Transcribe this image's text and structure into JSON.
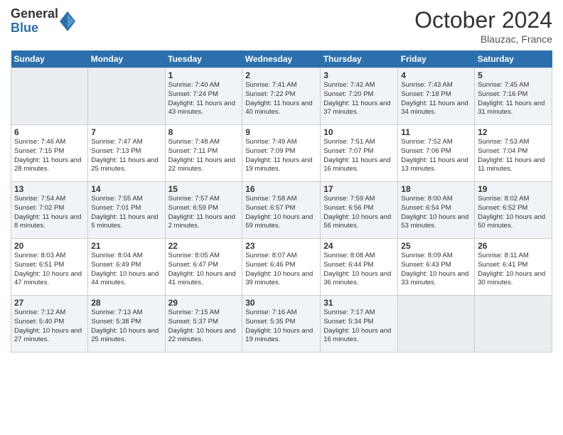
{
  "header": {
    "logo_general": "General",
    "logo_blue": "Blue",
    "month_title": "October 2024",
    "location": "Blauzac, France"
  },
  "days_of_week": [
    "Sunday",
    "Monday",
    "Tuesday",
    "Wednesday",
    "Thursday",
    "Friday",
    "Saturday"
  ],
  "weeks": [
    [
      {
        "day": "",
        "sunrise": "",
        "sunset": "",
        "daylight": ""
      },
      {
        "day": "",
        "sunrise": "",
        "sunset": "",
        "daylight": ""
      },
      {
        "day": "1",
        "sunrise": "Sunrise: 7:40 AM",
        "sunset": "Sunset: 7:24 PM",
        "daylight": "Daylight: 11 hours and 43 minutes."
      },
      {
        "day": "2",
        "sunrise": "Sunrise: 7:41 AM",
        "sunset": "Sunset: 7:22 PM",
        "daylight": "Daylight: 11 hours and 40 minutes."
      },
      {
        "day": "3",
        "sunrise": "Sunrise: 7:42 AM",
        "sunset": "Sunset: 7:20 PM",
        "daylight": "Daylight: 11 hours and 37 minutes."
      },
      {
        "day": "4",
        "sunrise": "Sunrise: 7:43 AM",
        "sunset": "Sunset: 7:18 PM",
        "daylight": "Daylight: 11 hours and 34 minutes."
      },
      {
        "day": "5",
        "sunrise": "Sunrise: 7:45 AM",
        "sunset": "Sunset: 7:16 PM",
        "daylight": "Daylight: 11 hours and 31 minutes."
      }
    ],
    [
      {
        "day": "6",
        "sunrise": "Sunrise: 7:46 AM",
        "sunset": "Sunset: 7:15 PM",
        "daylight": "Daylight: 11 hours and 28 minutes."
      },
      {
        "day": "7",
        "sunrise": "Sunrise: 7:47 AM",
        "sunset": "Sunset: 7:13 PM",
        "daylight": "Daylight: 11 hours and 25 minutes."
      },
      {
        "day": "8",
        "sunrise": "Sunrise: 7:48 AM",
        "sunset": "Sunset: 7:11 PM",
        "daylight": "Daylight: 11 hours and 22 minutes."
      },
      {
        "day": "9",
        "sunrise": "Sunrise: 7:49 AM",
        "sunset": "Sunset: 7:09 PM",
        "daylight": "Daylight: 11 hours and 19 minutes."
      },
      {
        "day": "10",
        "sunrise": "Sunrise: 7:51 AM",
        "sunset": "Sunset: 7:07 PM",
        "daylight": "Daylight: 11 hours and 16 minutes."
      },
      {
        "day": "11",
        "sunrise": "Sunrise: 7:52 AM",
        "sunset": "Sunset: 7:06 PM",
        "daylight": "Daylight: 11 hours and 13 minutes."
      },
      {
        "day": "12",
        "sunrise": "Sunrise: 7:53 AM",
        "sunset": "Sunset: 7:04 PM",
        "daylight": "Daylight: 11 hours and 11 minutes."
      }
    ],
    [
      {
        "day": "13",
        "sunrise": "Sunrise: 7:54 AM",
        "sunset": "Sunset: 7:02 PM",
        "daylight": "Daylight: 11 hours and 8 minutes."
      },
      {
        "day": "14",
        "sunrise": "Sunrise: 7:55 AM",
        "sunset": "Sunset: 7:01 PM",
        "daylight": "Daylight: 11 hours and 5 minutes."
      },
      {
        "day": "15",
        "sunrise": "Sunrise: 7:57 AM",
        "sunset": "Sunset: 6:59 PM",
        "daylight": "Daylight: 11 hours and 2 minutes."
      },
      {
        "day": "16",
        "sunrise": "Sunrise: 7:58 AM",
        "sunset": "Sunset: 6:57 PM",
        "daylight": "Daylight: 10 hours and 59 minutes."
      },
      {
        "day": "17",
        "sunrise": "Sunrise: 7:59 AM",
        "sunset": "Sunset: 6:56 PM",
        "daylight": "Daylight: 10 hours and 56 minutes."
      },
      {
        "day": "18",
        "sunrise": "Sunrise: 8:00 AM",
        "sunset": "Sunset: 6:54 PM",
        "daylight": "Daylight: 10 hours and 53 minutes."
      },
      {
        "day": "19",
        "sunrise": "Sunrise: 8:02 AM",
        "sunset": "Sunset: 6:52 PM",
        "daylight": "Daylight: 10 hours and 50 minutes."
      }
    ],
    [
      {
        "day": "20",
        "sunrise": "Sunrise: 8:03 AM",
        "sunset": "Sunset: 6:51 PM",
        "daylight": "Daylight: 10 hours and 47 minutes."
      },
      {
        "day": "21",
        "sunrise": "Sunrise: 8:04 AM",
        "sunset": "Sunset: 6:49 PM",
        "daylight": "Daylight: 10 hours and 44 minutes."
      },
      {
        "day": "22",
        "sunrise": "Sunrise: 8:05 AM",
        "sunset": "Sunset: 6:47 PM",
        "daylight": "Daylight: 10 hours and 41 minutes."
      },
      {
        "day": "23",
        "sunrise": "Sunrise: 8:07 AM",
        "sunset": "Sunset: 6:46 PM",
        "daylight": "Daylight: 10 hours and 39 minutes."
      },
      {
        "day": "24",
        "sunrise": "Sunrise: 8:08 AM",
        "sunset": "Sunset: 6:44 PM",
        "daylight": "Daylight: 10 hours and 36 minutes."
      },
      {
        "day": "25",
        "sunrise": "Sunrise: 8:09 AM",
        "sunset": "Sunset: 6:43 PM",
        "daylight": "Daylight: 10 hours and 33 minutes."
      },
      {
        "day": "26",
        "sunrise": "Sunrise: 8:11 AM",
        "sunset": "Sunset: 6:41 PM",
        "daylight": "Daylight: 10 hours and 30 minutes."
      }
    ],
    [
      {
        "day": "27",
        "sunrise": "Sunrise: 7:12 AM",
        "sunset": "Sunset: 5:40 PM",
        "daylight": "Daylight: 10 hours and 27 minutes."
      },
      {
        "day": "28",
        "sunrise": "Sunrise: 7:13 AM",
        "sunset": "Sunset: 5:38 PM",
        "daylight": "Daylight: 10 hours and 25 minutes."
      },
      {
        "day": "29",
        "sunrise": "Sunrise: 7:15 AM",
        "sunset": "Sunset: 5:37 PM",
        "daylight": "Daylight: 10 hours and 22 minutes."
      },
      {
        "day": "30",
        "sunrise": "Sunrise: 7:16 AM",
        "sunset": "Sunset: 5:35 PM",
        "daylight": "Daylight: 10 hours and 19 minutes."
      },
      {
        "day": "31",
        "sunrise": "Sunrise: 7:17 AM",
        "sunset": "Sunset: 5:34 PM",
        "daylight": "Daylight: 10 hours and 16 minutes."
      },
      {
        "day": "",
        "sunrise": "",
        "sunset": "",
        "daylight": ""
      },
      {
        "day": "",
        "sunrise": "",
        "sunset": "",
        "daylight": ""
      }
    ]
  ]
}
